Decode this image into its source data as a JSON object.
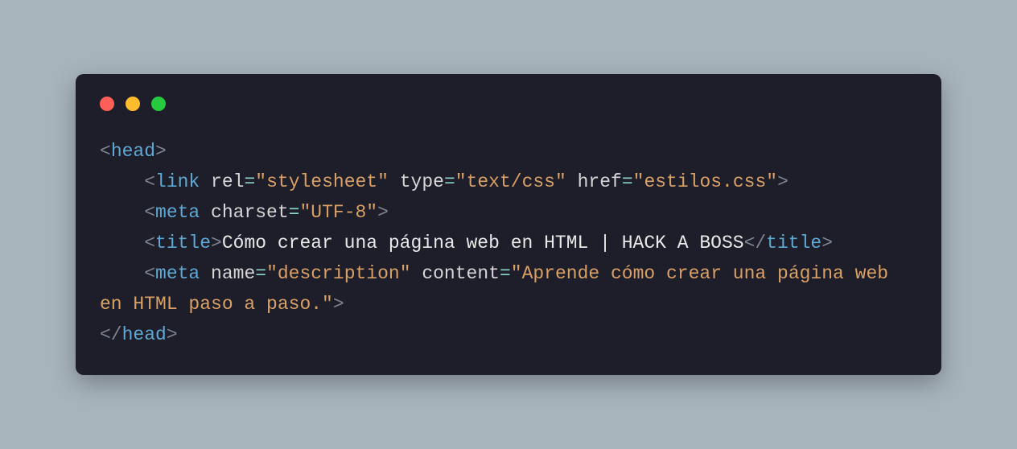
{
  "code": {
    "line1": {
      "open_bracket": "<",
      "tag": "head",
      "close_bracket": ">"
    },
    "line2": {
      "open_bracket": "<",
      "tag": "link",
      "attr1": "rel",
      "eq1": "=",
      "val1": "\"stylesheet\"",
      "attr2": "type",
      "eq2": "=",
      "val2": "\"text/css\"",
      "attr3": "href",
      "eq3": "=",
      "val3": "\"estilos.css\"",
      "close_bracket": ">"
    },
    "line3": {
      "open_bracket": "<",
      "tag": "meta",
      "attr1": "charset",
      "eq1": "=",
      "val1": "\"UTF-8\"",
      "close_bracket": ">"
    },
    "line4": {
      "open_bracket": "<",
      "tag_open": "title",
      "close_bracket1": ">",
      "text": "Cómo crear una página web en HTML | HACK A BOSS",
      "open_close": "</",
      "tag_close": "title",
      "close_bracket2": ">"
    },
    "line5": {
      "open_bracket": "<",
      "tag": "meta",
      "attr1": "name",
      "eq1": "=",
      "val1": "\"description\"",
      "attr2": "content",
      "eq2": "=",
      "val2": "\"Aprende cómo crear una página web en HTML paso a paso.\"",
      "close_bracket": ">"
    },
    "line6": {
      "open_close": "</",
      "tag": "head",
      "close_bracket": ">"
    }
  }
}
